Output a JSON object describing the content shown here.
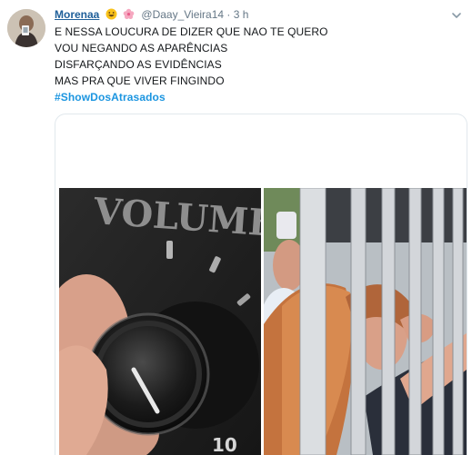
{
  "tweet": {
    "author_name": "Morenaa",
    "author_emojis": [
      "grinning-face-emoji",
      "cherry-blossom-emoji"
    ],
    "handle": "@Daay_Vieira14",
    "separator": "·",
    "time": "3 h",
    "lines": [
      "E NESSA LOUCURA DE DIZER QUE NAO TE QUERO",
      "VOU NEGANDO AS APARÊNCIAS",
      "DISFARÇANDO AS EVIDÊNCIAS",
      "MAS PRA QUE VIVER FINGINDO"
    ],
    "hashtag": "#ShowDosAtrasados",
    "media": {
      "left_image_text": "VOLUME",
      "left_image_knob_number": "10"
    }
  },
  "colors": {
    "name": "#1f5f99",
    "hashtag": "#1b95e0",
    "muted": "#657786"
  },
  "icons": {
    "menu": "chevron-down-icon"
  }
}
